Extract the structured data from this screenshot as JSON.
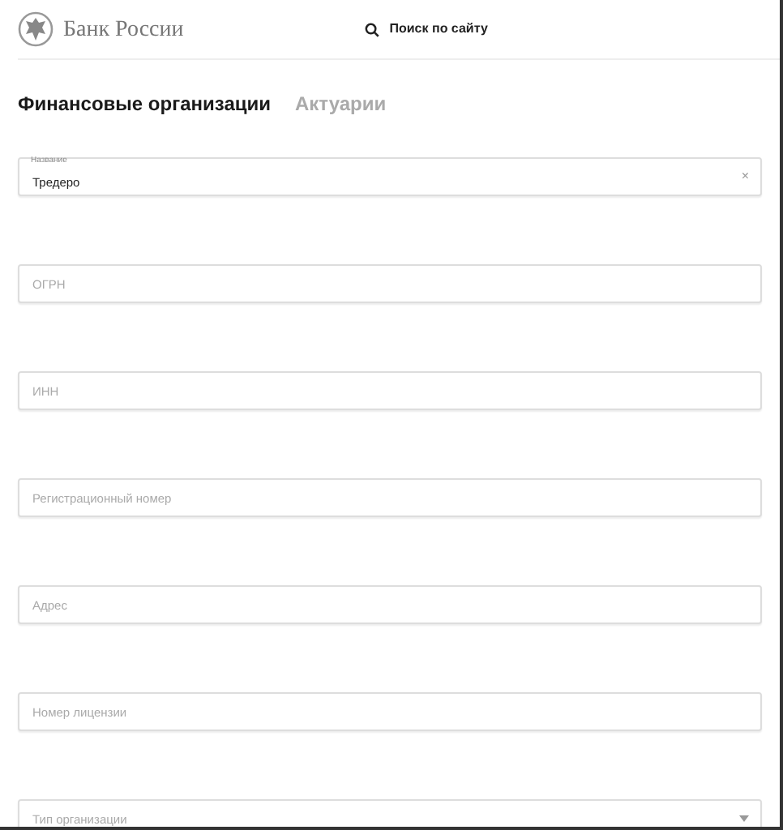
{
  "header": {
    "logo_text": "Банк России",
    "search_label": "Поиск по сайту"
  },
  "tabs": [
    {
      "label": "Финансовые организации",
      "selected": true
    },
    {
      "label": "Актуарии",
      "selected": false
    }
  ],
  "fields": [
    {
      "kind": "text",
      "label": "Название",
      "value": "Тредеро",
      "clear": "×"
    },
    {
      "kind": "text",
      "placeholder": "ОГРН"
    },
    {
      "kind": "text",
      "placeholder": "ИНН"
    },
    {
      "kind": "text",
      "placeholder": "Регистрационный номер"
    },
    {
      "kind": "text",
      "placeholder": "Адрес"
    },
    {
      "kind": "text",
      "placeholder": "Номер лицензии"
    },
    {
      "kind": "select",
      "placeholder": "Тип организации"
    }
  ]
}
